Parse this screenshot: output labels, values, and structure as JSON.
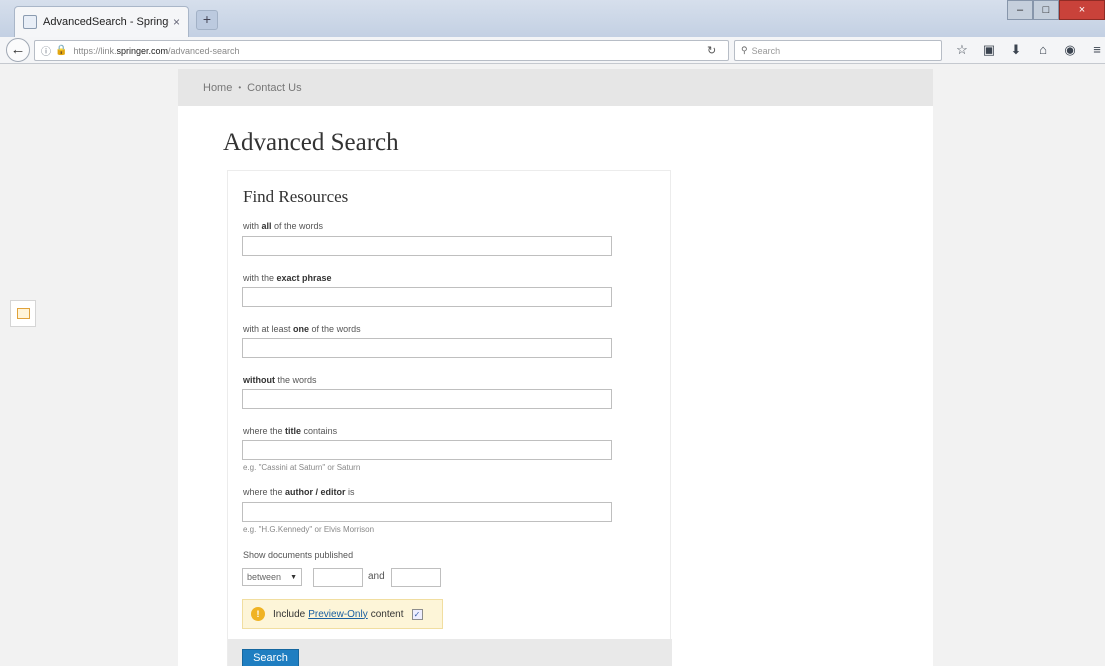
{
  "browser": {
    "tab_title": "AdvancedSearch - Springer",
    "tab_close": "×",
    "new_tab": "+",
    "url_protocol": "https://link.",
    "url_domain": "springer.com",
    "url_path": "/advanced-search",
    "search_placeholder": "Search",
    "window_controls": [
      "–",
      "□",
      "×"
    ]
  },
  "breadcrumb": {
    "home": "Home",
    "separator": "•",
    "contact": "Contact Us"
  },
  "page": {
    "title": "Advanced Search"
  },
  "form": {
    "title": "Find Resources",
    "fields": [
      {
        "pre": "with ",
        "bold": "all",
        "post": " of the words"
      },
      {
        "pre": "with the ",
        "bold": "exact phrase",
        "post": ""
      },
      {
        "pre": "with at least ",
        "bold": "one",
        "post": " of the words"
      },
      {
        "pre": "",
        "bold": "without",
        "post": " the words"
      },
      {
        "pre": "where the ",
        "bold": "title",
        "post": " contains"
      },
      {
        "pre": "where the ",
        "bold": "author / editor",
        "post": " is"
      }
    ],
    "title_hint": "e.g. \"Cassini at Saturn\" or Saturn",
    "author_hint": "e.g. \"H.G.Kennedy\" or Elvis Morrison",
    "date_label": "Show documents published",
    "date_select": "between",
    "date_and": "and",
    "preview_prefix": "Include",
    "preview_link": "Preview-Only",
    "preview_suffix": "content",
    "search_button": "Search"
  },
  "colors": {
    "primary_button": "#1f7ec1",
    "preview_bg": "#fdf5d8",
    "close_button": "#c9423a"
  }
}
